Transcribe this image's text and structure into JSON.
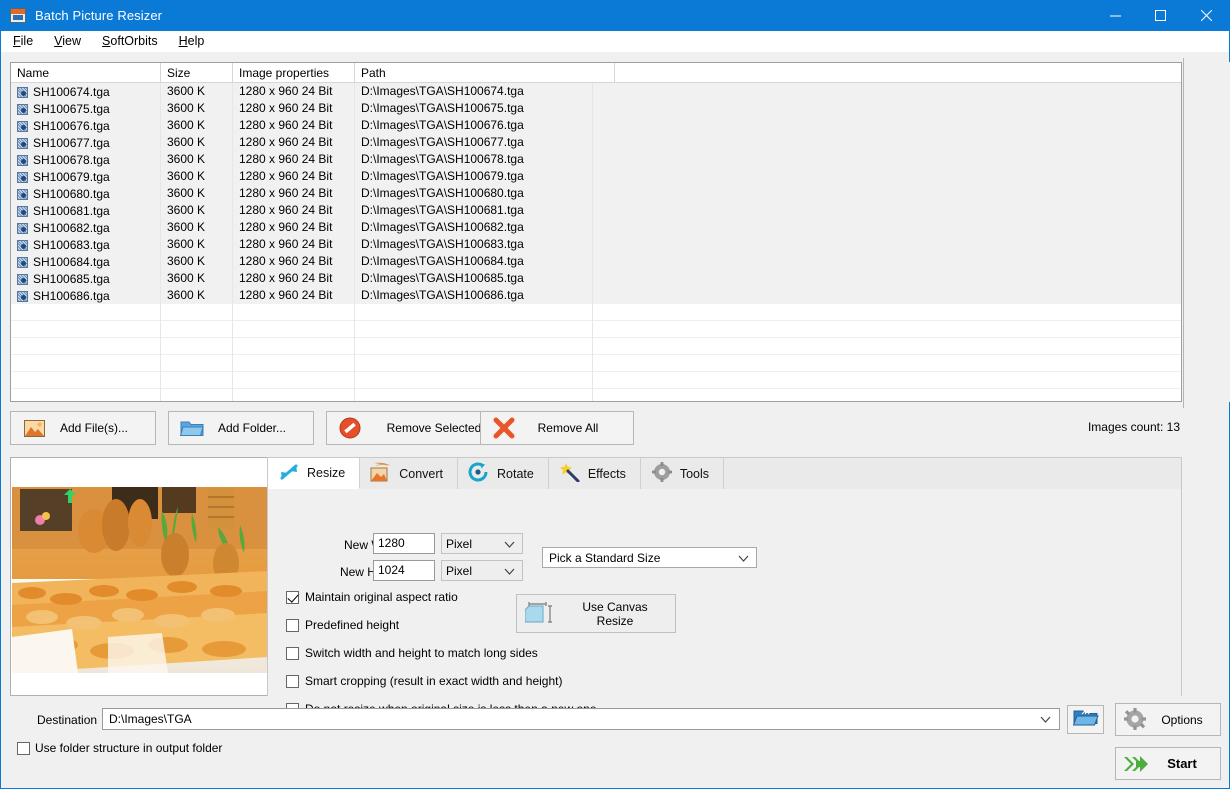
{
  "window": {
    "title": "Batch Picture Resizer",
    "icon": "app-icon",
    "minimize": "─",
    "maximize": "□",
    "close": "✕"
  },
  "menu": [
    {
      "label": "File",
      "accel": "F"
    },
    {
      "label": "View",
      "accel": "V"
    },
    {
      "label": "SoftOrbits",
      "accel": "S"
    },
    {
      "label": "Help",
      "accel": "H"
    }
  ],
  "file_list": {
    "columns": [
      "Name",
      "Size",
      "Image properties",
      "Path"
    ],
    "rows": [
      {
        "name": "SH100674.tga",
        "size": "3600 K",
        "props": "1280 x 960  24 Bit",
        "path": "D:\\Images\\TGA\\SH100674.tga"
      },
      {
        "name": "SH100675.tga",
        "size": "3600 K",
        "props": "1280 x 960  24 Bit",
        "path": "D:\\Images\\TGA\\SH100675.tga"
      },
      {
        "name": "SH100676.tga",
        "size": "3600 K",
        "props": "1280 x 960  24 Bit",
        "path": "D:\\Images\\TGA\\SH100676.tga"
      },
      {
        "name": "SH100677.tga",
        "size": "3600 K",
        "props": "1280 x 960  24 Bit",
        "path": "D:\\Images\\TGA\\SH100677.tga"
      },
      {
        "name": "SH100678.tga",
        "size": "3600 K",
        "props": "1280 x 960  24 Bit",
        "path": "D:\\Images\\TGA\\SH100678.tga"
      },
      {
        "name": "SH100679.tga",
        "size": "3600 K",
        "props": "1280 x 960  24 Bit",
        "path": "D:\\Images\\TGA\\SH100679.tga"
      },
      {
        "name": "SH100680.tga",
        "size": "3600 K",
        "props": "1280 x 960  24 Bit",
        "path": "D:\\Images\\TGA\\SH100680.tga"
      },
      {
        "name": "SH100681.tga",
        "size": "3600 K",
        "props": "1280 x 960  24 Bit",
        "path": "D:\\Images\\TGA\\SH100681.tga"
      },
      {
        "name": "SH100682.tga",
        "size": "3600 K",
        "props": "1280 x 960  24 Bit",
        "path": "D:\\Images\\TGA\\SH100682.tga"
      },
      {
        "name": "SH100683.tga",
        "size": "3600 K",
        "props": "1280 x 960  24 Bit",
        "path": "D:\\Images\\TGA\\SH100683.tga"
      },
      {
        "name": "SH100684.tga",
        "size": "3600 K",
        "props": "1280 x 960  24 Bit",
        "path": "D:\\Images\\TGA\\SH100684.tga"
      },
      {
        "name": "SH100685.tga",
        "size": "3600 K",
        "props": "1280 x 960  24 Bit",
        "path": "D:\\Images\\TGA\\SH100685.tga"
      },
      {
        "name": "SH100686.tga",
        "size": "3600 K",
        "props": "1280 x 960  24 Bit",
        "path": "D:\\Images\\TGA\\SH100686.tga"
      }
    ]
  },
  "view_modes": [
    {
      "name": "thumbnail-view-icon",
      "selected": false
    },
    {
      "name": "list-view-icon",
      "selected": false
    },
    {
      "name": "grid-view-icon",
      "selected": true
    }
  ],
  "actions": {
    "add_files": "Add File(s)...",
    "add_folder": "Add Folder...",
    "remove_selected": "Remove Selected",
    "remove_all": "Remove All",
    "images_count": "Images count: 13"
  },
  "tabs": [
    {
      "label": "Resize",
      "icon": "resize-arrows-icon",
      "active": true
    },
    {
      "label": "Convert",
      "icon": "convert-image-icon",
      "active": false
    },
    {
      "label": "Rotate",
      "icon": "rotate-arrow-icon",
      "active": false
    },
    {
      "label": "Effects",
      "icon": "magic-wand-icon",
      "active": false
    },
    {
      "label": "Tools",
      "icon": "gear-icon",
      "active": false
    }
  ],
  "resize": {
    "width_label": "New Width",
    "width_value": "1280",
    "width_unit": "Pixel",
    "height_label": "New Height",
    "height_value": "1024",
    "height_unit": "Pixel",
    "standard_size": "Pick a Standard Size",
    "canvas_resize": "Use Canvas Resize",
    "checkboxes": [
      {
        "label": "Maintain original aspect ratio",
        "checked": true
      },
      {
        "label": "Predefined height",
        "checked": false
      },
      {
        "label": "Switch width and height to match long sides",
        "checked": false
      },
      {
        "label": "Smart cropping (result in exact width and height)",
        "checked": false
      },
      {
        "label": "Do not resize when original size is less then a new one",
        "checked": false
      }
    ]
  },
  "bottom": {
    "destination_label": "Destination",
    "destination_value": "D:\\Images\\TGA",
    "use_folder_structure": "Use folder structure in output folder",
    "use_folder_structure_checked": false,
    "options": "Options",
    "start": "Start"
  },
  "colors": {
    "titlebar": "#0a7ad6",
    "accent_green": "#4caf3d",
    "accent_orange": "#e06a28",
    "panel": "#f0f0f0"
  }
}
